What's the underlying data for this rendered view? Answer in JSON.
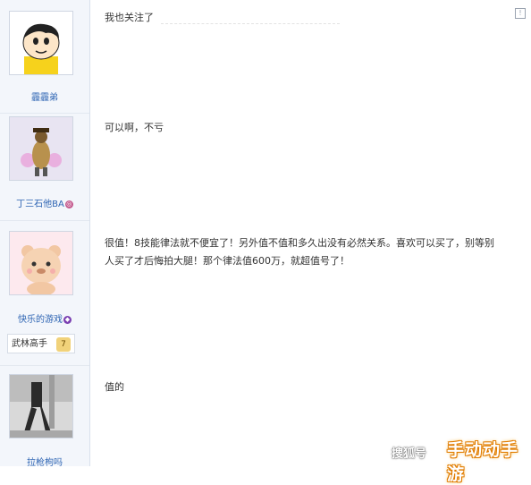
{
  "posts": [
    {
      "username": "霾霾弟",
      "message": "我也关注了",
      "avatar": "crayon-shinchan-avatar"
    },
    {
      "username": "丁三石他BA",
      "message": "可以啊，不亏",
      "avatar": "genie-character-avatar"
    },
    {
      "username": "快乐的游戏",
      "message": "很值！8技能律法就不便宜了！另外值不值和多久出没有必然关系。喜欢可以买了，别等别人买了才后悔拍大腿！那个律法值600万，就超值号了！",
      "avatar": "cute-bear-avatar",
      "rank_title": "武林高手",
      "rank_level": "7"
    },
    {
      "username": "拉枪枸吗",
      "message": "值的",
      "avatar": "street-photo-avatar"
    }
  ],
  "watermarks": {
    "sohu": "搜狐号",
    "brand": "手动动手游"
  },
  "colors": {
    "username": "#2d64b3",
    "sidebar_bg": "#f3f6fb",
    "accent": "#f7a400"
  }
}
